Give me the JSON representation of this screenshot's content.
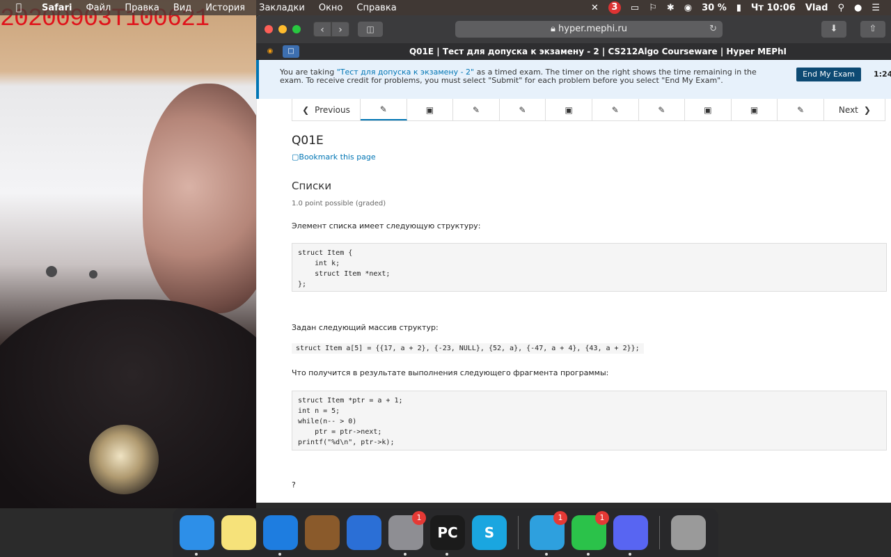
{
  "overlay": {
    "timestamp": "20200903T100621"
  },
  "menubar": {
    "apple_icon": "apple-icon",
    "items": [
      "Safari",
      "Файл",
      "Правка",
      "Вид",
      "История",
      "Закладки",
      "Окно",
      "Справка"
    ],
    "status": {
      "battery": "30 %",
      "clock": "Чт 10:06",
      "user": "Vlad",
      "badge": "3"
    }
  },
  "browser": {
    "url": "hyper.mephi.ru",
    "tab_title": "Q01E | Тест для допуска к экзамену - 2 | CS212Algo Courseware | Hyper MEPhI"
  },
  "exam_banner": {
    "text_before": "You are taking ",
    "exam_link": "\"Тест для допуска к экзамену - 2\"",
    "text_after": " as a timed exam. The timer on the right shows the time remaining in the exam. To receive credit for problems, you must select \"Submit\" for each problem before you select \"End My Exam\".",
    "end_button": "End My Exam",
    "timer": "1:24:"
  },
  "sequence_nav": {
    "previous": "Previous",
    "next": "Next"
  },
  "problem": {
    "title": "Q01E",
    "bookmark": "Bookmark this page",
    "section": "Списки",
    "points": "1.0 point possible (graded)",
    "intro": "Элемент списка имеет следующую структуру:",
    "struct_code": "struct Item {\n    int k;\n    struct Item *next;\n};",
    "array_intro": "Задан следующий массив структур:",
    "array_code": "struct Item a[5] = {{17, a + 2}, {-23, NULL}, {52, a}, {-47, a + 4}, {43, a + 2}};",
    "question": "Что получится в результате выполнения следующего фрагмента программы:",
    "program_code": "struct Item *ptr = a + 1;\nint n = 5;\nwhile(n-- > 0)\n    ptr = ptr->next;\nprintf(\"%d\\n\", ptr->k);",
    "answer_prompt": "?"
  },
  "dock": {
    "apps": [
      {
        "name": "finder",
        "label": "",
        "color": "#2d8fe8",
        "running": true
      },
      {
        "name": "notes",
        "label": "",
        "color": "#f6e27a",
        "running": false
      },
      {
        "name": "safari",
        "label": "",
        "color": "#1e7de0",
        "running": true
      },
      {
        "name": "garageband",
        "label": "",
        "color": "#8a5a2b",
        "running": false
      },
      {
        "name": "xcode",
        "label": "",
        "color": "#2b6fd6",
        "running": false
      },
      {
        "name": "system-preferences",
        "label": "",
        "color": "#8e8e93",
        "running": true,
        "badge": "1"
      },
      {
        "name": "pycharm",
        "label": "PC",
        "color": "#1b1b1b",
        "running": true
      },
      {
        "name": "skype",
        "label": "S",
        "color": "#1aa6e0",
        "running": false
      },
      {
        "name": "telegram",
        "label": "",
        "color": "#2ea0de",
        "running": true,
        "badge": "1"
      },
      {
        "name": "facetime",
        "label": "",
        "color": "#2bc24a",
        "running": true,
        "badge": "1"
      },
      {
        "name": "discord",
        "label": "",
        "color": "#5865f2",
        "running": true
      },
      {
        "name": "trash",
        "label": "",
        "color": "#9a9a9a",
        "running": false
      }
    ]
  }
}
